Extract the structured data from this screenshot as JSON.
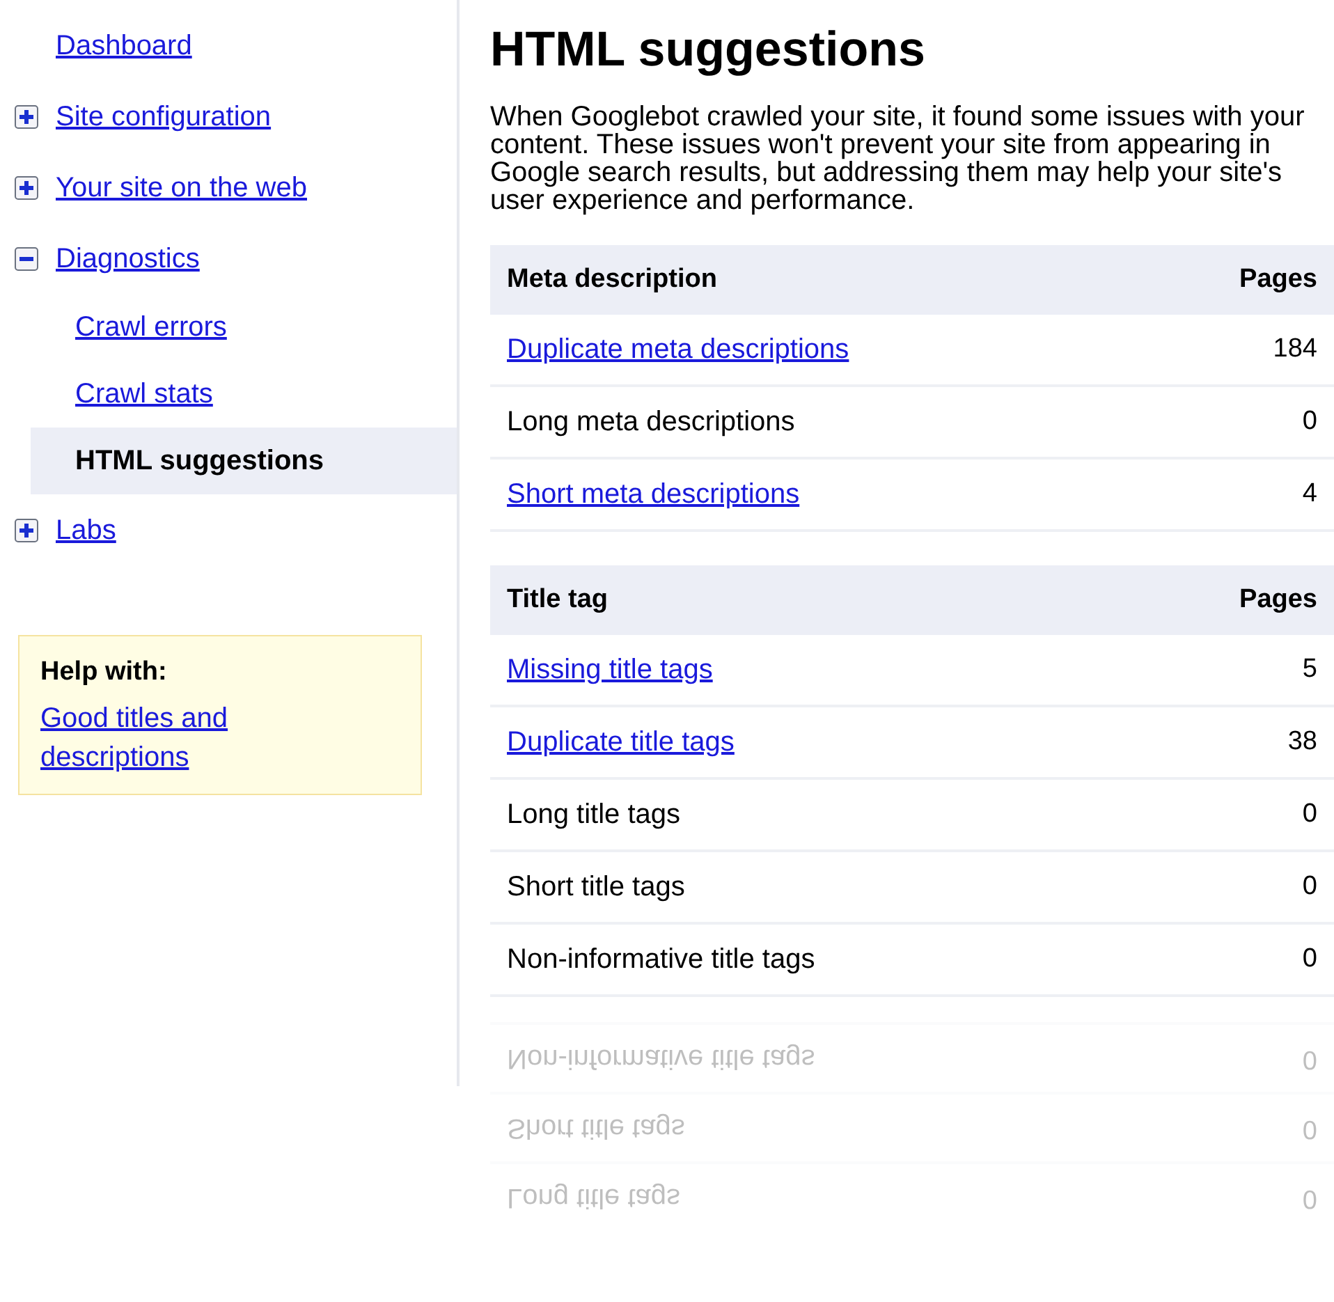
{
  "sidebar": {
    "items": [
      {
        "label": "Dashboard",
        "selected": false
      },
      {
        "label": "Site configuration",
        "expanded": false,
        "selected": false
      },
      {
        "label": "Your site on the web",
        "expanded": false,
        "selected": false
      },
      {
        "label": "Diagnostics",
        "expanded": true,
        "selected": false,
        "children": [
          {
            "label": "Crawl errors",
            "selected": false
          },
          {
            "label": "Crawl stats",
            "selected": false
          },
          {
            "label": "HTML suggestions",
            "selected": true
          }
        ]
      },
      {
        "label": "Labs",
        "expanded": false,
        "selected": false
      }
    ],
    "help": {
      "title": "Help with:",
      "link": "Good titles and descriptions"
    }
  },
  "main": {
    "title": "HTML suggestions",
    "intro": "When Googlebot crawled your site, it found some issues with your content. These issues won't prevent your site from appearing in Google search results, but addressing them may help your site's user experience and performance.",
    "tables": [
      {
        "columns": [
          "Meta description",
          "Pages"
        ],
        "rows": [
          {
            "label": "Duplicate meta descriptions",
            "pages": "184",
            "link": true
          },
          {
            "label": "Long meta descriptions",
            "pages": "0",
            "link": false
          },
          {
            "label": "Short meta descriptions",
            "pages": "4",
            "link": true
          }
        ]
      },
      {
        "columns": [
          "Title tag",
          "Pages"
        ],
        "rows": [
          {
            "label": "Missing title tags",
            "pages": "5",
            "link": true
          },
          {
            "label": "Duplicate title tags",
            "pages": "38",
            "link": true
          },
          {
            "label": "Long title tags",
            "pages": "0",
            "link": false
          },
          {
            "label": "Short title tags",
            "pages": "0",
            "link": false
          },
          {
            "label": "Non-informative title tags",
            "pages": "0",
            "link": false
          }
        ]
      }
    ],
    "reflection": [
      {
        "label": "Non-informative title tags",
        "pages": "0"
      },
      {
        "label": "Short title tags",
        "pages": "0"
      },
      {
        "label": "Long title tags",
        "pages": "0"
      }
    ]
  }
}
